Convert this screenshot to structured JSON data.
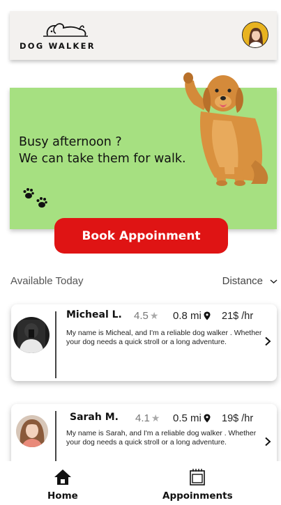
{
  "header": {
    "logo_text": "DOG WALKER"
  },
  "banner": {
    "line1": "Busy afternoon ?",
    "line2": "We can take them for walk.",
    "cta_label": "Book Appoinment"
  },
  "list": {
    "section_label": "Available Today",
    "sort_label": "Distance"
  },
  "walkers": [
    {
      "name": "Micheal L.",
      "rating": "4.5",
      "distance": "0.8 mi",
      "price": "21$ /hr",
      "bio": "My name is Micheal, and I'm a reliable dog walker . Whether your dog needs a quick stroll or a long adventure."
    },
    {
      "name": "Sarah M.",
      "rating": "4.1",
      "distance": "0.5 mi",
      "price": "19$ /hr",
      "bio": "My name is Sarah, and I'm a reliable dog walker . Whether your dog needs a quick stroll or a long adventure."
    }
  ],
  "nav": {
    "home_label": "Home",
    "appointments_label": "Appoinments"
  },
  "icons": {
    "star": "star-icon",
    "pin": "location-pin-icon",
    "chevron": "chevron-right-icon",
    "home": "home-icon",
    "calendar": "calendar-icon",
    "paw": "paw-prints-icon"
  },
  "colors": {
    "accent": "#df1414",
    "banner_bg": "#a6e081",
    "header_bg": "#f3f1ef"
  }
}
